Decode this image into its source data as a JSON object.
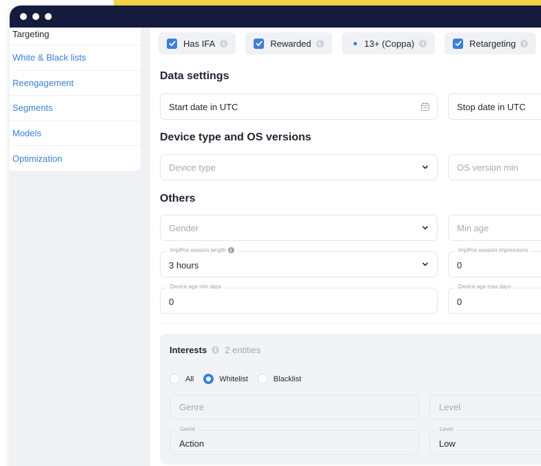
{
  "colors": {
    "accent": "#3b7fd8",
    "titlebar": "#141b3c",
    "highlight": "#f6d447"
  },
  "sidebar": {
    "items": [
      {
        "label": "Targeting"
      },
      {
        "label": "White & Black lists"
      },
      {
        "label": "Reengagement"
      },
      {
        "label": "Segments"
      },
      {
        "label": "Models"
      },
      {
        "label": "Optimization"
      }
    ]
  },
  "flags": {
    "has_ifa": {
      "label": "Has IFA",
      "checked": true
    },
    "rewarded": {
      "label": "Rewarded",
      "checked": true
    },
    "coppa": {
      "label": "13+ (Coppa)",
      "checked": false
    },
    "retargeting": {
      "label": "Retargeting",
      "checked": true
    }
  },
  "data_settings": {
    "title": "Data settings",
    "start_date": "Start date in UTC",
    "stop_date": "Stop date in UTC"
  },
  "device": {
    "title": "Device type and OS versions",
    "device_type_placeholder": "Device type",
    "os_version_min_placeholder": "OS version min"
  },
  "others": {
    "title": "Others",
    "gender_placeholder": "Gender",
    "min_age_placeholder": "Min age",
    "session_length": {
      "label": "ImpPos session length",
      "value": "3 hours"
    },
    "session_impressions": {
      "label": "ImpPos session impressions",
      "value": "0"
    },
    "device_age_min": {
      "label": "Device age min days",
      "value": "0"
    },
    "device_age_max": {
      "label": "Device age max days",
      "value": "0"
    }
  },
  "interests": {
    "title": "Interests",
    "count": "2 entities",
    "mode": {
      "all": "All",
      "whitelist": "Whitelist",
      "blacklist": "Blacklist",
      "selected": "Whitelist"
    },
    "genre_placeholder": "Genre",
    "level_placeholder": "Level",
    "row": {
      "genre_label": "Genre",
      "genre_value": "Action",
      "level_label": "Level",
      "level_value": "Low"
    }
  }
}
